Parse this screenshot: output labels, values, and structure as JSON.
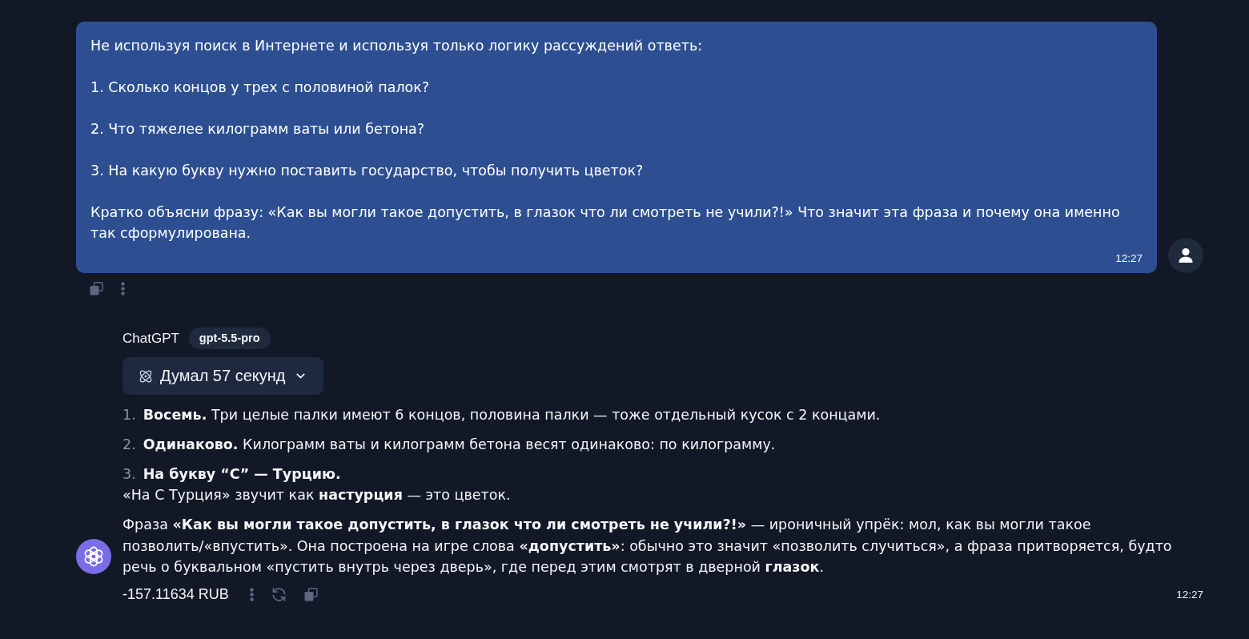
{
  "user_message": {
    "paragraphs": [
      "Не используя поиск в Интернете и используя только логику рассуждений ответь:",
      "1. Сколько концов у трех с половиной палок?",
      "2. Что тяжелее килограмм ваты или бетона?",
      "3. На какую букву нужно поставить государство, чтобы получить цветок?",
      "Кратко объясни фразу: «Как вы могли такое допустить, в глазок что ли смотреть не учили?!» Что значит эта фраза и почему она именно так сформулирована."
    ],
    "time": "12:27"
  },
  "assistant": {
    "name": "ChatGPT",
    "model": "gpt-5.5-pro",
    "thinking": {
      "label": "Думал 57 секунд",
      "expanded": false
    },
    "answers": [
      {
        "number": "1.",
        "lead": "Восемь.",
        "text": "Три целые палки имеют 6 концов, половина палки — тоже отдельный кусок с 2 концами."
      },
      {
        "number": "2.",
        "lead": "Одинаково.",
        "text": "Килограмм ваты и килограмм бетона весят одинаково: по килограмму."
      },
      {
        "number": "3.",
        "lead": "На букву “С” — Турцию.",
        "note": "«На С Турция» звучит как **настурция** — это цветок."
      }
    ],
    "explanation": "Фраза **«Как вы могли такое допустить, в глазок что ли смотреть не учили?!»** — ироничный упрёк: мол, как вы могли такое позволить/«впустить». Она построена на игре слова **«допустить»**: обычно это значит «позволить случиться», а фраза притворяется, будто речь о буквальном «пустить внутрь через дверь», где перед этим смотрят в дверной **глазок**.",
    "cost": "-157.11634 RUB",
    "time": "12:27"
  }
}
